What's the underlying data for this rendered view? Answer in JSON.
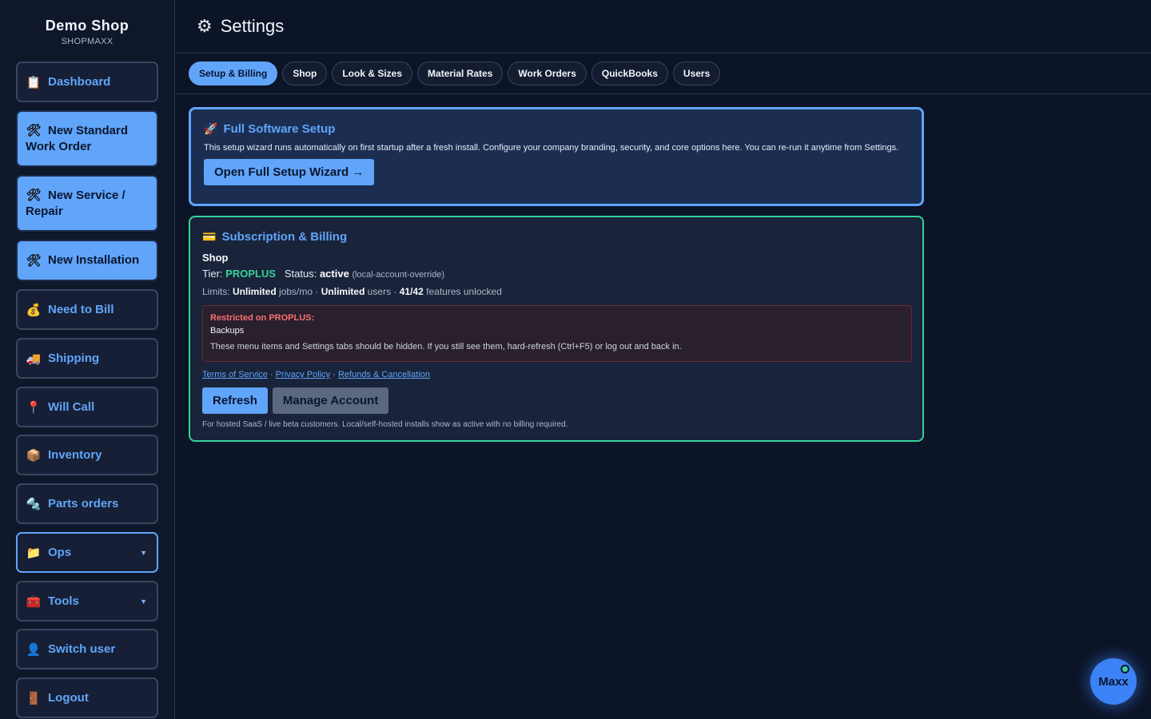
{
  "brand": {
    "title": "Demo Shop",
    "subtitle": "SHOPMAXX"
  },
  "sidebar": {
    "items": [
      {
        "icon": "clipboard-icon",
        "label": "Dashboard"
      },
      {
        "icon": "tools-icon",
        "label": "New Standard Work Order"
      },
      {
        "icon": "tools-icon",
        "label": "New Service / Repair"
      },
      {
        "icon": "tools-icon",
        "label": "New Installation"
      },
      {
        "icon": "money-bag-icon",
        "label": "Need to Bill"
      },
      {
        "icon": "truck-icon",
        "label": "Shipping"
      },
      {
        "icon": "pin-icon",
        "label": "Will Call"
      },
      {
        "icon": "box-icon",
        "label": "Inventory"
      },
      {
        "icon": "parts-icon",
        "label": "Parts orders"
      },
      {
        "icon": "folder-icon",
        "label": "Ops",
        "caret": "▼"
      },
      {
        "icon": "toolbox-icon",
        "label": "Tools",
        "caret": "▼"
      },
      {
        "icon": "user-icon",
        "label": "Switch user"
      },
      {
        "icon": "door-icon",
        "label": "Logout"
      }
    ]
  },
  "header": {
    "icon": "gear-icon",
    "title": "Settings"
  },
  "tabs": [
    {
      "label": "Setup & Billing",
      "active": true
    },
    {
      "label": "Shop"
    },
    {
      "label": "Look & Sizes"
    },
    {
      "label": "Material Rates"
    },
    {
      "label": "Work Orders"
    },
    {
      "label": "QuickBooks"
    },
    {
      "label": "Users"
    }
  ],
  "setup": {
    "icon": "rocket-icon",
    "title": "Full Software Setup",
    "description": "This setup wizard runs automatically on first startup after a fresh install. Configure your company branding, security, and core options here. You can re-run it anytime from Settings.",
    "button": "Open Full Setup Wizard →"
  },
  "billing": {
    "icon": "credit-card-icon",
    "title": "Subscription & Billing",
    "shop_name": "Shop",
    "tier_label": "Tier:",
    "tier_value": "PROPLUS",
    "status_label": "Status:",
    "status_value": "active",
    "status_note": "(local-account-override)",
    "limits": {
      "prefix": "Limits:",
      "jobs_value": "Unlimited",
      "jobs_unit": "jobs/mo ·",
      "users_value": "Unlimited",
      "users_unit": "users ·",
      "features_value": "41/42",
      "features_unit": "features unlocked"
    },
    "restricted": {
      "title": "Restricted on PROPLUS:",
      "item": "Backups",
      "note": "These menu items and Settings tabs should be hidden. If you still see them, hard-refresh (Ctrl+F5) or log out and back in."
    },
    "links": [
      "Terms of Service",
      "Privacy Policy",
      "Refunds & Cancellation"
    ],
    "separator": "·",
    "refresh_button": "Refresh",
    "manage_button": "Manage Account",
    "footnote": "For hosted SaaS / live beta customers. Local/self-hosted installs show as active with no billing required."
  },
  "assistant": {
    "label": "Maxx"
  },
  "colors": {
    "background": "#0c1427",
    "accent": "#60a5fa",
    "success": "#34d399",
    "danger": "#f87171"
  }
}
